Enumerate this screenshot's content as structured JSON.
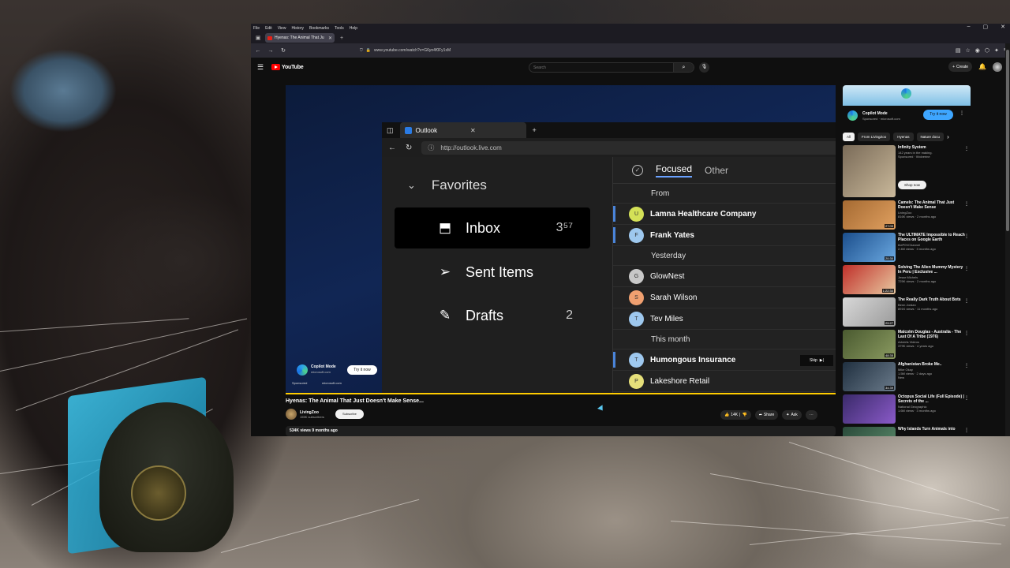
{
  "browser": {
    "menu": [
      "File",
      "Edit",
      "View",
      "History",
      "Bookmarks",
      "Tools",
      "Help"
    ],
    "tab_title": "Hyenas: The Animal That Ju",
    "url": "www.youtube.com/watch?v=G6yn4f0Fy1xM",
    "window_controls": [
      "–",
      "▢",
      "✕"
    ]
  },
  "youtube": {
    "logo_text": "YouTube",
    "search_placeholder": "Search",
    "create_label": "Create"
  },
  "video": {
    "inner_browser": {
      "tab_title": "Outlook",
      "address": "http://outlook.live.com"
    },
    "outlook": {
      "favorites_label": "Favorites",
      "folders": [
        {
          "label": "Inbox",
          "count": "3⁵⁷",
          "icon": "inbox-icon"
        },
        {
          "label": "Sent Items",
          "count": "",
          "icon": "send-icon"
        },
        {
          "label": "Drafts",
          "count": "2",
          "icon": "pencil-icon"
        }
      ],
      "tabs": {
        "focused": "Focused",
        "other": "Other"
      },
      "groups": {
        "from": "From",
        "yesterday": "Yesterday",
        "this_month": "This month"
      },
      "messages": [
        {
          "initial": "U",
          "name": "Lamna Healthcare Company",
          "color": "#d4e157",
          "unread": true
        },
        {
          "initial": "F",
          "name": "Frank Yates",
          "color": "#9ec8ee",
          "unread": true
        },
        {
          "initial": "G",
          "name": "GlowNest",
          "color": "#c8c8c8",
          "unread": false
        },
        {
          "initial": "S",
          "name": "Sarah Wilson",
          "color": "#f0a070",
          "unread": false
        },
        {
          "initial": "T",
          "name": "Tev Miles",
          "color": "#9ec8ee",
          "unread": false
        },
        {
          "initial": "T",
          "name": "Humongous Insurance",
          "color": "#9ec8ee",
          "unread": true
        },
        {
          "initial": "P",
          "name": "Lakeshore Retail",
          "color": "#e6e07a",
          "unread": false
        }
      ]
    },
    "ad": {
      "title": "Copilot Mode",
      "domain": "microsoft.com",
      "cta": "Try it now",
      "sponsored": "Sponsored",
      "skip": "Skip"
    },
    "progress": 1.0,
    "title": "Hyenas: The Animal That Just Doesn't Make Sense...",
    "channel": "LivingZoo",
    "subscribers": "155K subscribers",
    "subscribe": "Subscribe",
    "likes": "14K",
    "share": "Share",
    "ask": "Ask",
    "meta": "534K views  9 months ago"
  },
  "sidebar": {
    "ad": {
      "title": "Copilot Mode",
      "sub": "Sponsored · microsoft.com",
      "cta": "Try it now"
    },
    "chips": [
      "All",
      "From LivingZoo",
      "Hyenas",
      "Nature docu"
    ],
    "items": [
      {
        "title": "Infinity System",
        "channel": "142 years in the making.",
        "meta": "Sponsored · Wolverine",
        "duration": "",
        "cta": "Shop now",
        "colors": [
          "#7a6b58",
          "#c9b89a"
        ]
      },
      {
        "title": "Camels: The Animal That Just Doesn't Make Sense",
        "channel": "LivingZoo",
        "meta": "816K views · 2 months ago",
        "duration": "27:09",
        "colors": [
          "#a56a32",
          "#e0a060"
        ]
      },
      {
        "title": "The ULTIMATE Impossible to Reach Places on Google Earth",
        "channel": "theP0VChannel",
        "meta": "2.4M views · 3 months ago",
        "duration": "20:30",
        "colors": [
          "#1b4e8c",
          "#6aa8e0"
        ]
      },
      {
        "title": "Solving The Alien Mummy Mystery In Peru | Exclusive ...",
        "channel": "Jesse Michels",
        "meta": "725K views · 2 months ago",
        "duration": "1:22:34",
        "colors": [
          "#c0302a",
          "#e8c8a0"
        ]
      },
      {
        "title": "The Really Dark Truth About Bots",
        "channel": "Benn Jordan",
        "meta": "891K views · 11 months ago",
        "duration": "29:27",
        "colors": [
          "#d8d8d8",
          "#9a9a9a"
        ]
      },
      {
        "title": "Malcolm Douglas - Australia - The Last Of A Tribe (1976)",
        "channel": "Adverts Videos",
        "meta": "379K views · 4 years ago",
        "duration": "48:35",
        "colors": [
          "#4a5a30",
          "#8a9a60"
        ]
      },
      {
        "title": "Afghanistan Broke Me..",
        "channel": "Mike Okay",
        "meta": "1.5M views · 2 days ago",
        "badge": "New",
        "duration": "34:39",
        "colors": [
          "#203040",
          "#6a7a8a"
        ]
      },
      {
        "title": "Octopus Social Life (Full Episode) | Secrets of the ...",
        "channel": "National Geographic",
        "meta": "1.6M views · 3 months ago",
        "duration": "",
        "colors": [
          "#3a2a6a",
          "#8a5ac8"
        ]
      },
      {
        "title": "Why Islands Turn Animals into",
        "channel": "",
        "meta": "",
        "duration": "",
        "colors": [
          "#2a4a3a",
          "#5a8a6a"
        ]
      }
    ]
  }
}
